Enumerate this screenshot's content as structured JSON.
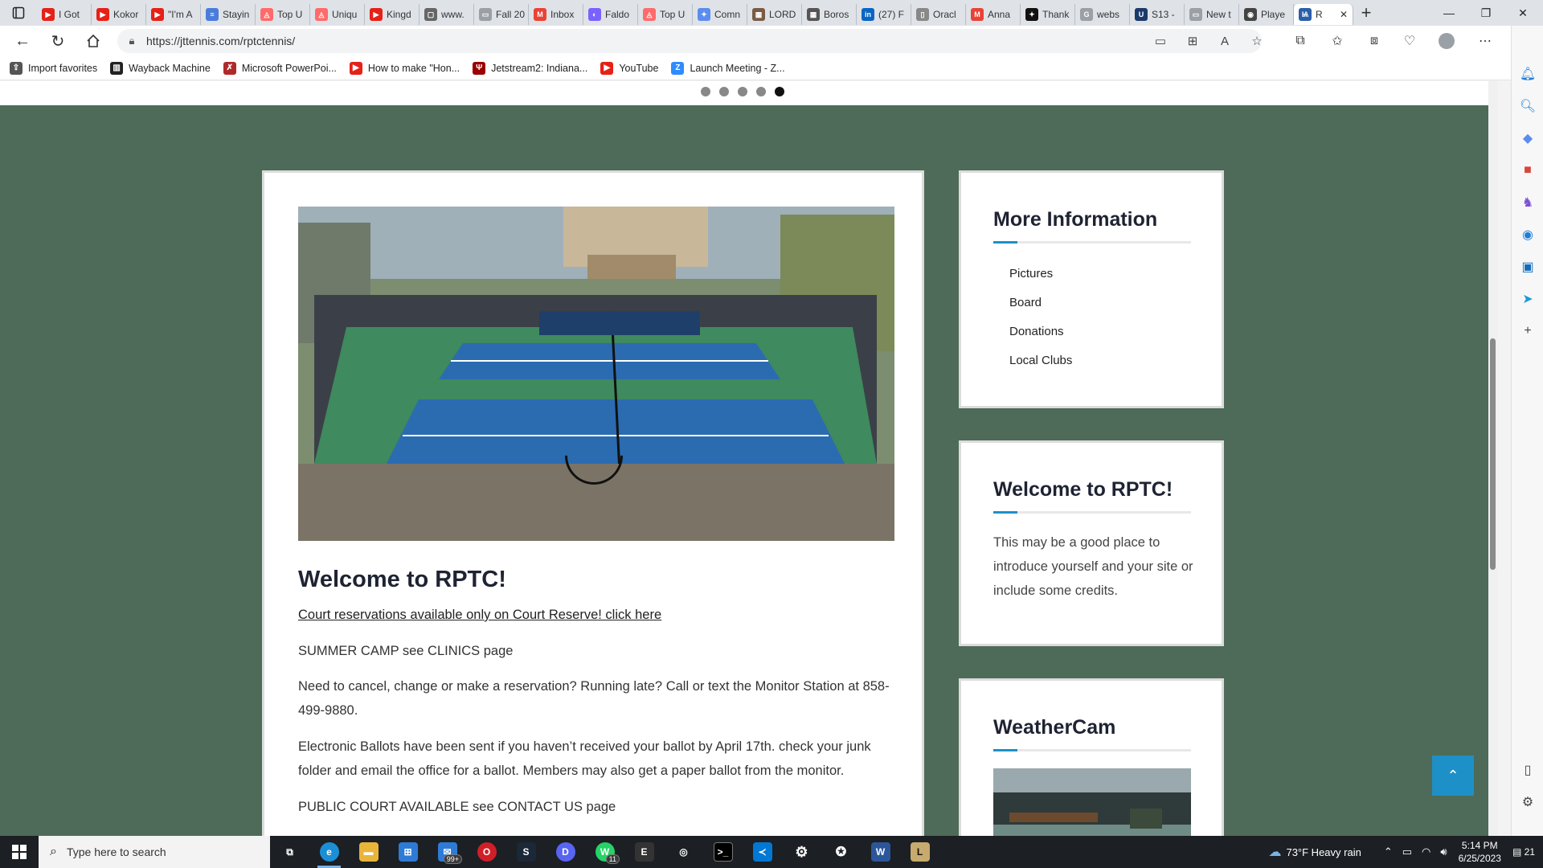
{
  "browser": {
    "tabs": [
      {
        "label": "I Got",
        "color": "#e62117",
        "glyph": "▶"
      },
      {
        "label": "Kokor",
        "color": "#e62117",
        "glyph": "▶"
      },
      {
        "label": "\"I'm A",
        "color": "#e62117",
        "glyph": "▶"
      },
      {
        "label": "Stayin",
        "color": "#4a7ddb",
        "glyph": "≡"
      },
      {
        "label": "Top U",
        "color": "#ff6b6b",
        "glyph": "◬"
      },
      {
        "label": "Uniqu",
        "color": "#ff6b6b",
        "glyph": "◬"
      },
      {
        "label": "Kingd",
        "color": "#e62117",
        "glyph": "▶"
      },
      {
        "label": "www.",
        "color": "#666666",
        "glyph": "▢"
      },
      {
        "label": "Fall 20",
        "color": "#9aa0a6",
        "glyph": "▭"
      },
      {
        "label": "Inbox",
        "color": "#ea4335",
        "glyph": "M"
      },
      {
        "label": "Faldo",
        "color": "#7b61ff",
        "glyph": "◐"
      },
      {
        "label": "Top U",
        "color": "#ff6b6b",
        "glyph": "◬"
      },
      {
        "label": "Comn",
        "color": "#5b8def",
        "glyph": "✦"
      },
      {
        "label": "LORD",
        "color": "#7a5c45",
        "glyph": "▦"
      },
      {
        "label": "Boros",
        "color": "#555555",
        "glyph": "▦"
      },
      {
        "label": "(27) F",
        "color": "#0a66c2",
        "glyph": "in"
      },
      {
        "label": "Oracl",
        "color": "#888888",
        "glyph": "▯"
      },
      {
        "label": "Anna",
        "color": "#ea4335",
        "glyph": "M"
      },
      {
        "label": "Thank",
        "color": "#111111",
        "glyph": "✦"
      },
      {
        "label": "webs",
        "color": "#9aa0a6",
        "glyph": "G"
      },
      {
        "label": "S13 -",
        "color": "#1a3a6b",
        "glyph": "U"
      },
      {
        "label": "New t",
        "color": "#9aa0a6",
        "glyph": "▭"
      },
      {
        "label": "Playe",
        "color": "#444444",
        "glyph": "◉"
      },
      {
        "label": "R",
        "color": "#2b5fa8",
        "glyph": "Ѩ"
      }
    ],
    "new_tab": "+",
    "window_controls": {
      "minimize": "—",
      "restore": "❐",
      "close": "✕"
    },
    "url": "https://jttennis.com/rptctennis/",
    "favorites": [
      {
        "label": "Import favorites",
        "color": "#555555",
        "glyph": "⇪"
      },
      {
        "label": "Wayback Machine",
        "color": "#222222",
        "glyph": "▥"
      },
      {
        "label": "Microsoft PowerPoi...",
        "color": "#b02a2a",
        "glyph": "✗"
      },
      {
        "label": "How to make \"Hon...",
        "color": "#e62117",
        "glyph": "▶"
      },
      {
        "label": "Jetstream2: Indiana...",
        "color": "#990000",
        "glyph": "Ψ"
      },
      {
        "label": "YouTube",
        "color": "#e62117",
        "glyph": "▶"
      },
      {
        "label": "Launch Meeting - Z...",
        "color": "#2d8cff",
        "glyph": "Z"
      }
    ]
  },
  "page": {
    "slider_dots": 5,
    "active_dot": 4,
    "main_title": "Welcome to RPTC!",
    "reservation_link": "Court reservations available only on Court Reserve! click here",
    "paragraphs": [
      "SUMMER CAMP see CLINICS page",
      "Need to cancel, change or make a reservation? Running late? Call or text the Monitor Station at 858-499-9880.",
      "Electronic Ballots have been sent if you haven’t received your ballot by April 17th. check your junk folder and email the office for a ballot. Members may also get a paper ballot from the monitor.",
      "PUBLIC COURT AVAILABLE see CONTACT US page"
    ],
    "sidebar": {
      "more_info_title": "More Information",
      "links": [
        "Pictures",
        "Board",
        "Donations",
        "Local Clubs"
      ],
      "welcome_title": "Welcome to RPTC!",
      "welcome_text": "This may be a good place to introduce yourself and your site or include some credits.",
      "weathercam_title": "WeatherCam"
    },
    "colors": {
      "background": "#4d6b58",
      "accent": "#1e90c8",
      "heading": "#1e2333"
    }
  },
  "taskbar": {
    "search_placeholder": "Type here to search",
    "weather": "73°F  Heavy rain",
    "time": "5:14 PM",
    "date": "6/25/2023",
    "notification_count": "21",
    "mail_badge": "99+",
    "whatsapp_badge": "11"
  }
}
